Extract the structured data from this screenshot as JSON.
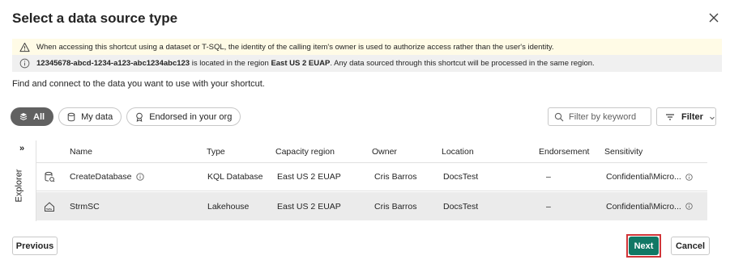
{
  "dialog": {
    "title": "Select a data source type",
    "subtitle": "Find and connect to the data you want to use with your shortcut."
  },
  "banners": {
    "warning_text": "When accessing this shortcut using a dataset or T-SQL, the identity of the calling item's owner is used to authorize access rather than the user's identity.",
    "info_id": "12345678-abcd-1234-a123-abc1234abc123",
    "info_mid": " is located in the region ",
    "info_region": "East US 2 EUAP",
    "info_tail": ". Any data sourced through this shortcut will be processed in the same region."
  },
  "filters": {
    "pills": [
      {
        "label": "All",
        "icon": "all-icon",
        "active": true
      },
      {
        "label": "My data",
        "icon": "database-icon",
        "active": false
      },
      {
        "label": "Endorsed in your org",
        "icon": "ribbon-icon",
        "active": false
      }
    ],
    "search_placeholder": "Filter by keyword",
    "filter_label": "Filter"
  },
  "explorer": {
    "label": "Explorer",
    "toggle": "»"
  },
  "table": {
    "columns": [
      "Name",
      "Type",
      "Capacity region",
      "Owner",
      "Location",
      "Endorsement",
      "Sensitivity"
    ],
    "rows": [
      {
        "icon": "kql-database-icon",
        "name": "CreateDatabase",
        "type": "KQL Database",
        "region": "East US 2 EUAP",
        "owner": "Cris Barros",
        "location": "DocsTest",
        "endorsement": "–",
        "sensitivity": "Confidential\\Micro..."
      },
      {
        "icon": "lakehouse-icon",
        "name": "StrmSC",
        "type": "Lakehouse",
        "region": "East US 2 EUAP",
        "owner": "Cris Barros",
        "location": "DocsTest",
        "endorsement": "–",
        "sensitivity": "Confidential\\Micro..."
      }
    ]
  },
  "footer": {
    "previous_label": "Previous",
    "next_label": "Next",
    "cancel_label": "Cancel"
  },
  "colors": {
    "primary": "#117865",
    "highlight_outline": "#d13438",
    "warning_bg": "#fffbe6",
    "info_bg": "#f0f0f0",
    "active_pill": "#616161"
  }
}
